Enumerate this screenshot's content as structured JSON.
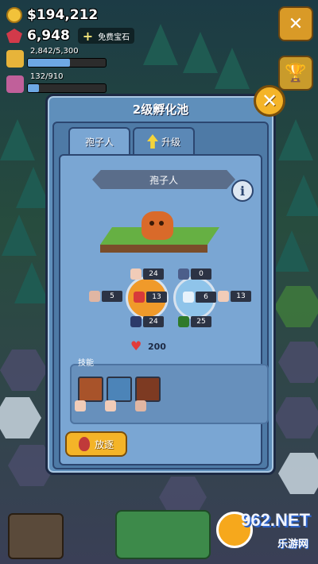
{
  "hud": {
    "coins": "$194,212",
    "gems": "6,948",
    "free_gems_label": "免费宝石",
    "bar1": {
      "label": "2,842/5,300",
      "progress": 0.536
    },
    "bar2": {
      "label": "132/910",
      "progress": 0.145
    }
  },
  "dialog": {
    "title": "2级孵化池",
    "tabs": [
      {
        "label": "孢子人",
        "active": true
      },
      {
        "label": "升级",
        "active": false
      }
    ],
    "creature_name": "孢子人",
    "info_label": "i",
    "stats": {
      "left": "5",
      "top_left": "24",
      "center_left": "13",
      "bottom_left": "24",
      "top_right": "0",
      "center_right": "6",
      "bottom_right": "25",
      "right": "13"
    },
    "hp": "200",
    "skills_title": "技能",
    "release_label": "放逐"
  },
  "watermark": {
    "main": "962.NET",
    "sub": "乐游网"
  },
  "colors": {
    "accent": "#f4b428",
    "panel": "#7aa6d3",
    "frame": "#5f8fbb"
  }
}
